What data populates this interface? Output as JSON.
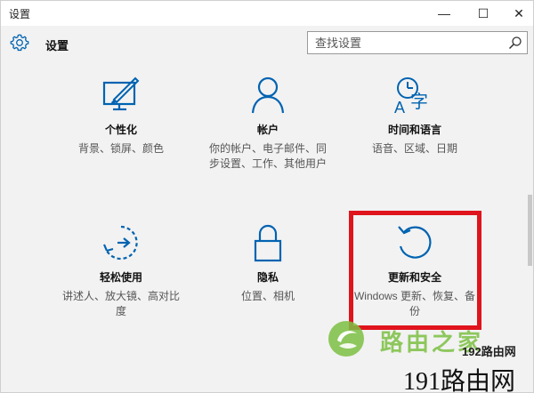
{
  "window": {
    "title": "设置",
    "minimize_symbol": "—",
    "maximize_symbol": "☐",
    "close_symbol": "✕"
  },
  "header": {
    "icon": "gear-icon",
    "title": "设置",
    "search_placeholder": "查找设置"
  },
  "tiles": [
    {
      "id": "personalization",
      "icon": "personalization-icon",
      "name": "个性化",
      "desc": "背景、锁屏、颜色"
    },
    {
      "id": "accounts",
      "icon": "person-icon",
      "name": "帐户",
      "desc": "你的帐户、电子邮件、同步设置、工作、其他用户"
    },
    {
      "id": "time",
      "icon": "clock-language-icon",
      "name": "时间和语言",
      "desc": "语音、区域、日期"
    },
    {
      "id": "ease",
      "icon": "ease-of-access-icon",
      "name": "轻松使用",
      "desc": "讲述人、放大镜、高对比度"
    },
    {
      "id": "privacy",
      "icon": "lock-icon",
      "name": "隐私",
      "desc": "位置、相机"
    },
    {
      "id": "update",
      "icon": "update-refresh-icon",
      "name": "更新和安全",
      "desc": "Windows 更新、恢复、备份"
    }
  ],
  "watermark": {
    "cn_text": "路由之家",
    "site_small": "192路由网",
    "site_large": "191路由网"
  },
  "colors": {
    "accent": "#0063b1",
    "highlight": "#e0141c",
    "watermark_green": "#7cc043"
  }
}
